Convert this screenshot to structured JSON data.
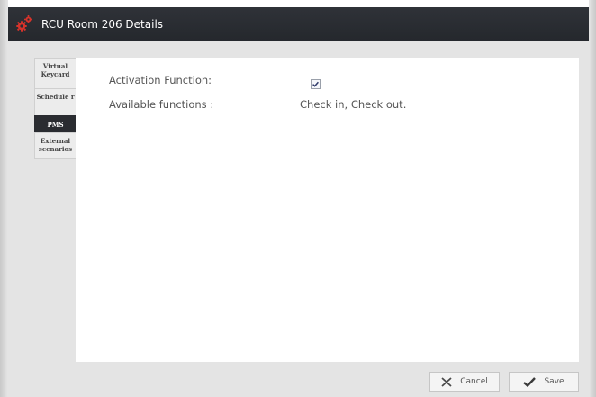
{
  "window": {
    "title": "RCU Room 206 Details",
    "icon": "gears-icon"
  },
  "tabs": [
    {
      "label": "Virtual Keycard",
      "active": false
    },
    {
      "label": "Schedule r",
      "active": false
    },
    {
      "label": "PMS",
      "active": true
    },
    {
      "label": "External scenarios",
      "active": false
    }
  ],
  "form": {
    "activation_label": "Activation Function:",
    "activation_checked": true,
    "available_label": "Available functions :",
    "available_value": "Check in, Check out."
  },
  "buttons": {
    "cancel_label": "Cancel",
    "save_label": "Save"
  },
  "colors": {
    "titlebar": "#2a2c31",
    "active_tab": "#2a2c31",
    "accent_icon": "#d6332b"
  }
}
